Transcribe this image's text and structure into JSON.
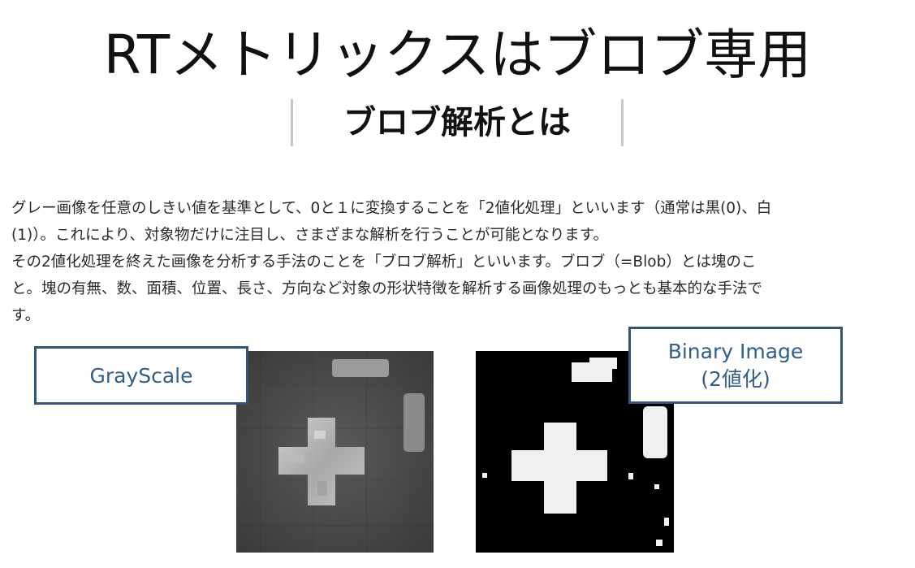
{
  "slide": {
    "title": "RTメトリックスはブロブ専用"
  },
  "section": {
    "heading": "ブロブ解析とは"
  },
  "paragraph": {
    "line1": "グレー画像を任意のしきい値を基準として、0と１に変換することを「2値化処理」といいます（通常は黒(0)、白",
    "line2": "(1)）。これにより、対象物だけに注目し、さまざまな解析を行うことが可能となります。",
    "line3": "その2値化処理を終えた画像を分析する手法のことを「ブロブ解析」といいます。ブロブ（=Blob）とは塊のこ",
    "line4": "と。塊の有無、数、面積、位置、長さ、方向など対象の形状特徴を解析する画像処理のもっとも基本的な手法で",
    "line5": "す。"
  },
  "labels": {
    "grayscale": "GrayScale",
    "binary_line1": "Binary Image",
    "binary_line2": "(2値化)"
  },
  "colors": {
    "label_text": "#2f5f8a",
    "label_border": "#33557a"
  }
}
